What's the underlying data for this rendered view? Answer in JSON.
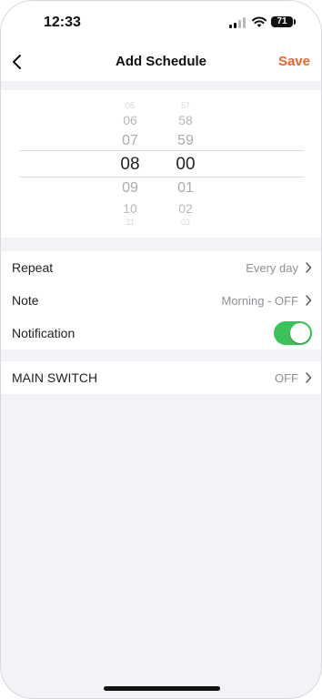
{
  "status_bar": {
    "time": "12:33",
    "battery": "71"
  },
  "header": {
    "title": "Add Schedule",
    "save_label": "Save"
  },
  "picker": {
    "hours": [
      "05",
      "06",
      "07",
      "08",
      "09",
      "10",
      "11"
    ],
    "minutes": [
      "57",
      "58",
      "59",
      "00",
      "01",
      "02",
      "03"
    ],
    "selected_hour": "08",
    "selected_minute": "00"
  },
  "settings": {
    "repeat": {
      "label": "Repeat",
      "value": "Every day"
    },
    "note": {
      "label": "Note",
      "value": "Morning - OFF"
    },
    "notification": {
      "label": "Notification",
      "enabled": true
    }
  },
  "switch": {
    "label": "MAIN SWITCH",
    "value": "OFF"
  },
  "colors": {
    "accent": "#f0632b",
    "toggle_on": "#3cc25a",
    "background": "#f2f3f7"
  }
}
